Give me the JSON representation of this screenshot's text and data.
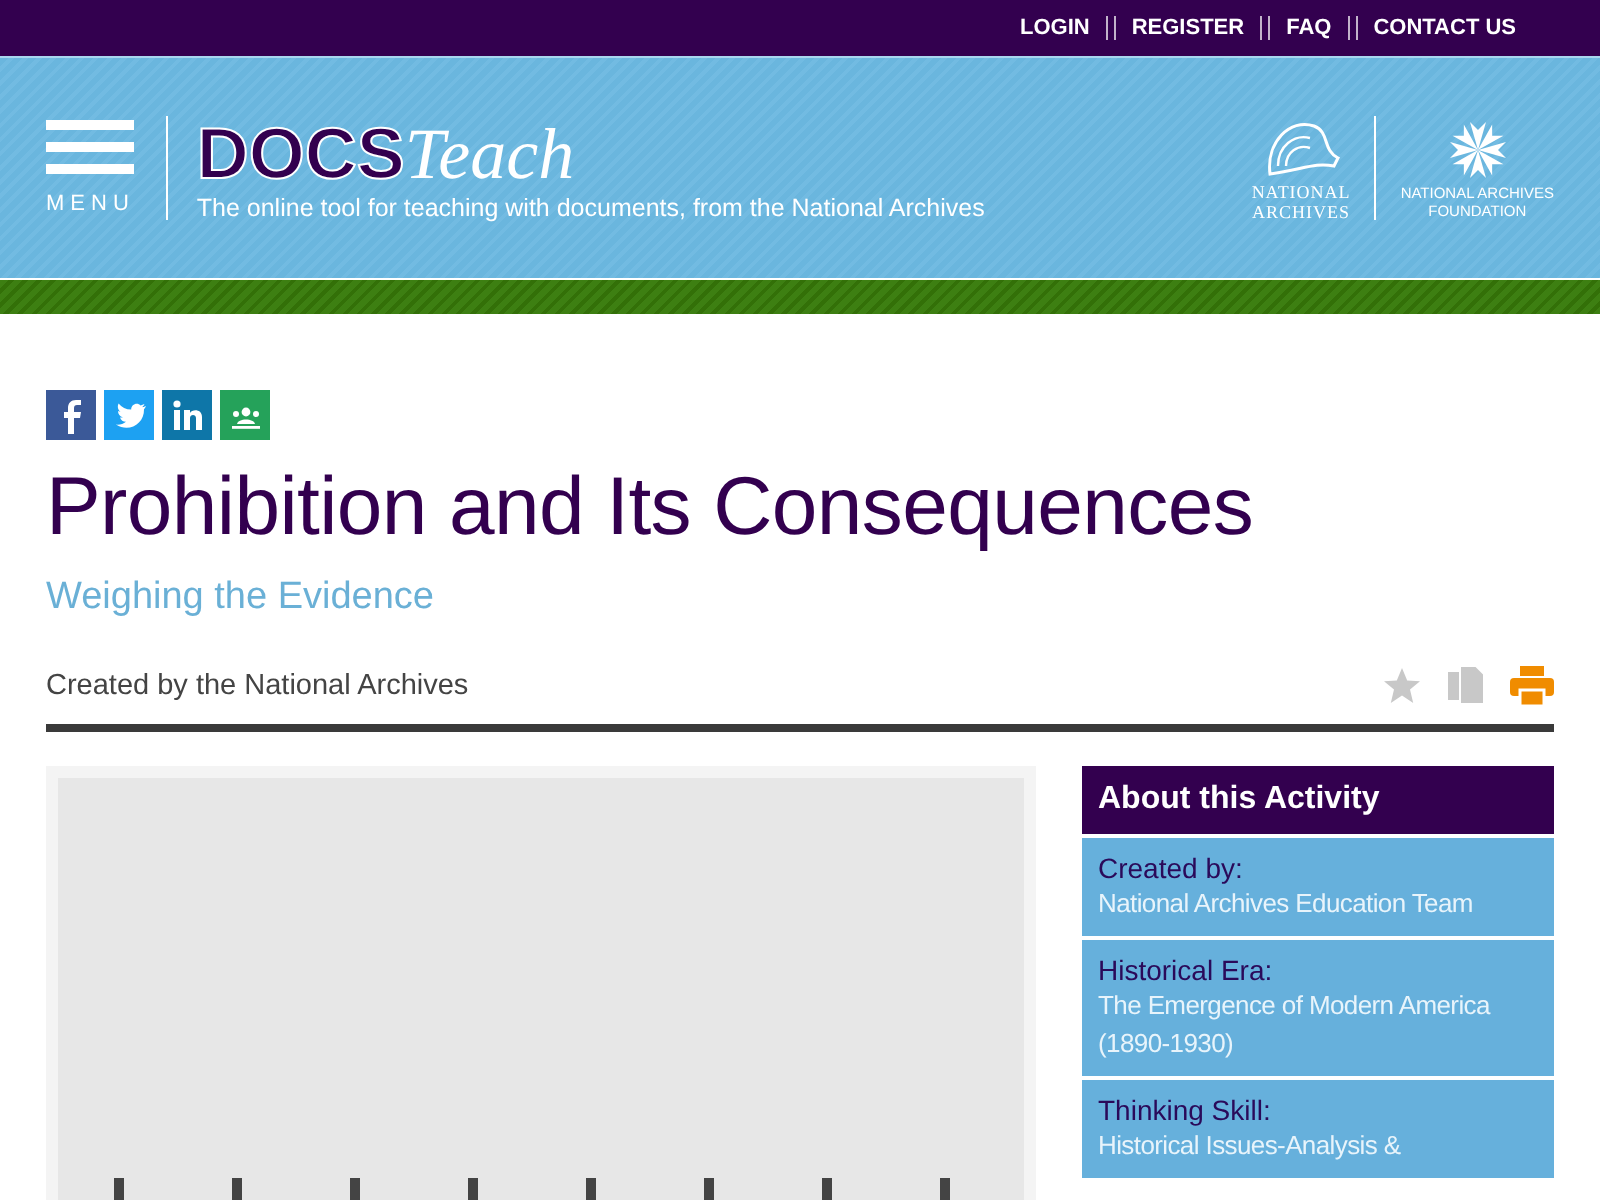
{
  "top_nav": [
    "LOGIN",
    "REGISTER",
    "FAQ",
    "CONTACT US"
  ],
  "header": {
    "menu_label": "MENU",
    "logo_bold": "DOCS",
    "logo_italic": "Teach",
    "tagline": "The online tool for teaching with documents, from the National Archives",
    "partner_1": [
      "NATIONAL",
      "ARCHIVES"
    ],
    "partner_2": [
      "NATIONAL ARCHIVES",
      "FOUNDATION"
    ]
  },
  "share": [
    {
      "kind": "facebook"
    },
    {
      "kind": "twitter"
    },
    {
      "kind": "linkedin"
    },
    {
      "kind": "classroom"
    }
  ],
  "title": "Prohibition and Its Consequences",
  "subtitle": "Weighing the Evidence",
  "credit": "Created by the National Archives",
  "about": {
    "heading": "About this Activity",
    "items": [
      {
        "label": "Created by:",
        "value": "National Archives Education Team"
      },
      {
        "label": "Historical Era:",
        "value": "The Emergence of Modern America (1890-1930)"
      },
      {
        "label": "Thinking Skill:",
        "value": "Historical Issues-Analysis &"
      }
    ]
  }
}
